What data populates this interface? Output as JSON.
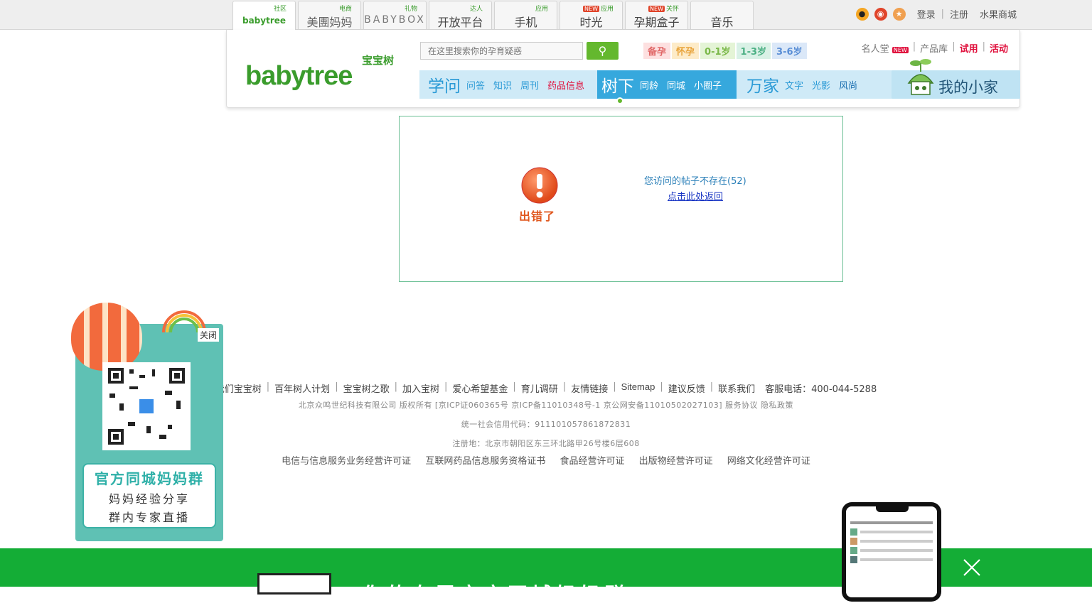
{
  "topbar": {
    "tabs": [
      {
        "tag": "社区",
        "name": "babytree",
        "new": false
      },
      {
        "tag": "电商",
        "name": "美團妈妈",
        "new": false
      },
      {
        "tag": "礼物",
        "name": "BABYBOX",
        "new": false
      },
      {
        "tag": "达人",
        "name": "开放平台",
        "new": false
      },
      {
        "tag": "应用",
        "name": "手机",
        "new": false
      },
      {
        "tag": "应用",
        "name": "时光",
        "new": true
      },
      {
        "tag": "关怀",
        "name": "孕期盒子",
        "new": true
      },
      {
        "tag": "",
        "name": "音乐",
        "new": false
      }
    ],
    "new_label": "NEW",
    "login": "登录",
    "register": "注册",
    "shop": "水果商城"
  },
  "header": {
    "logo_cn": "宝宝树",
    "logo_en": "babytree",
    "search_placeholder": "在这里搜索你的孕育疑惑",
    "stages": [
      "备孕",
      "怀孕",
      "0-1岁",
      "1-3岁",
      "3-6岁"
    ],
    "right_links": {
      "fame": "名人堂",
      "fame_new": "NEW",
      "products": "产品库",
      "trial": "试用",
      "activity": "活动"
    },
    "nav": {
      "xuewen": "学问",
      "xuewen_items": [
        "问答",
        "知识",
        "周刊",
        "药品信息"
      ],
      "shuxia": "树下",
      "shuxia_items": [
        "同龄",
        "同城",
        "小圈子"
      ],
      "wanjia": "万家",
      "wanjia_items": [
        "文字",
        "光影",
        "风尚"
      ],
      "home": "我的小家"
    }
  },
  "error": {
    "label": "出错了",
    "message": "您访问的帖子不存在(52)",
    "link": "点击此处返回"
  },
  "footer": {
    "nav": [
      "我们宝宝树",
      "百年树人计划",
      "宝宝树之歌",
      "加入宝树",
      "爱心希望基金",
      "育儿调研",
      "友情链接",
      "Sitemap",
      "建议反馈",
      "联系我们"
    ],
    "hotline": "客服电话：400-044-5288",
    "line1": "北京众鸣世纪科技有限公司 版权所有 [京ICP证060365号 京ICP备11010348号-1 京公网安备11010502027103] 服务协议 隐私政策",
    "line2": "统一社会信用代码：911101057861872831",
    "line3": "注册地：北京市朝阳区东三环北路甲26号楼6层608",
    "licenses": [
      "电信与信息服务业务经营许可证",
      "互联网药品信息服务资格证书",
      "食品经营许可证",
      "出版物经营许可证",
      "网络文化经营许可证"
    ]
  },
  "float_ad": {
    "close": "关闭",
    "title": "官方同城妈妈群",
    "line1": "妈妈经验分享",
    "line2": "群内专家直播"
  },
  "banner": {
    "title": "你的专属宝宝同城妈妈群"
  },
  "colors": {
    "green": "#14ad36",
    "brand_green": "#3a9c2c",
    "nav_blue": "#36a8dd",
    "error_red": "#e0581f"
  }
}
